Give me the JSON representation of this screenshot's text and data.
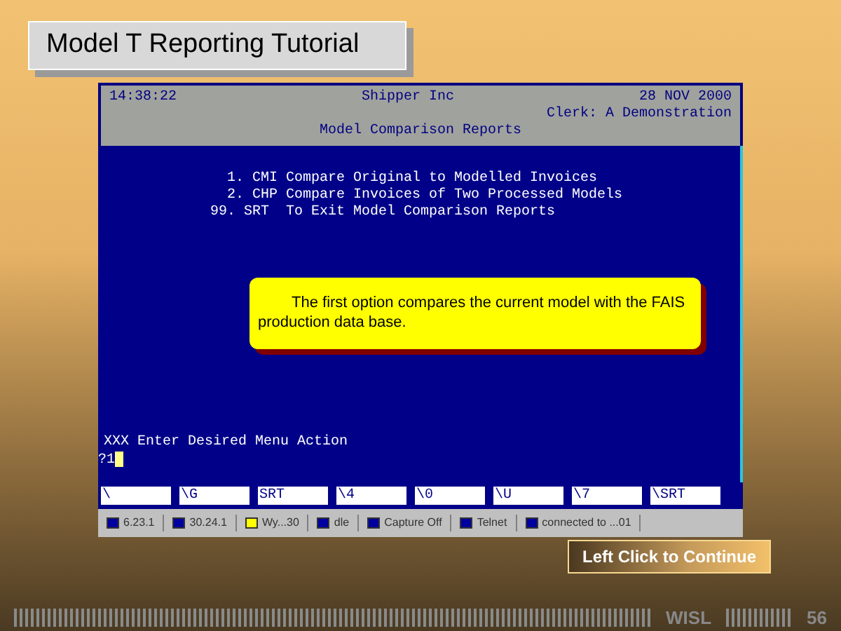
{
  "slide_title": "Model T Reporting Tutorial",
  "terminal": {
    "time": "14:38:22",
    "company": "Shipper Inc",
    "date": "28 NOV 2000",
    "clerk": "Clerk: A Demonstration",
    "screen_title": "Model Comparison Reports",
    "menu": [
      "1. CMI Compare Original to Modelled Invoices",
      "2. CHP Compare Invoices of Two Processed Models",
      "99. SRT  To Exit Model Comparison Reports"
    ],
    "prompt": "XXX Enter Desired Menu Action",
    "input": "?1",
    "function_keys": [
      "\\",
      "\\G",
      "SRT",
      "\\4",
      "\\0",
      "\\U",
      "\\7",
      "\\SRT"
    ]
  },
  "callout": "The first option compares the current model with the FAIS production data base.",
  "taskbar": [
    "6.23.1",
    "30.24.1",
    "Wy...30",
    "dle",
    "Capture Off",
    "Telnet",
    "connected to ...01"
  ],
  "continue_button": "Left Click to Continue",
  "footer": {
    "label": "WISL",
    "page": "56"
  }
}
